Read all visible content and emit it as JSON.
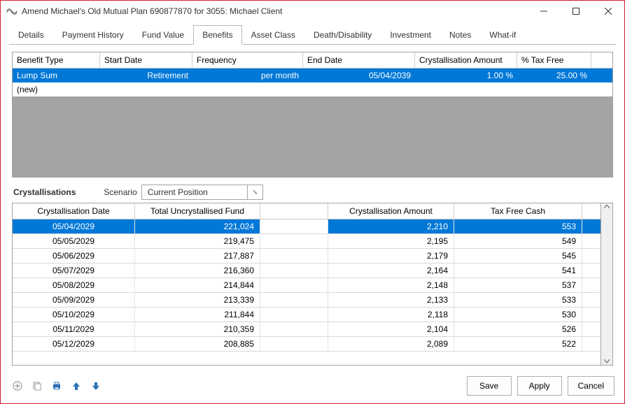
{
  "window": {
    "title": "Amend Michael's Old Mutual Plan 690877870 for 3055: Michael Client"
  },
  "tabs": [
    "Details",
    "Payment History",
    "Fund Value",
    "Benefits",
    "Asset Class",
    "Death/Disability",
    "Investment",
    "Notes",
    "What-if"
  ],
  "active_tab_index": 3,
  "benefit_grid": {
    "headers": [
      "Benefit Type",
      "Start Date",
      "Frequency",
      "End Date",
      "Crystallisation Amount",
      "% Tax Free"
    ],
    "rows": [
      {
        "selected": true,
        "cells": [
          "Lump Sum",
          "Retirement",
          "per month",
          "05/04/2039",
          "1.00 %",
          "25.00 %"
        ]
      },
      {
        "selected": false,
        "cells": [
          "(new)",
          "",
          "",
          "",
          "",
          ""
        ]
      }
    ]
  },
  "cryst_section": {
    "title": "Crystallisations",
    "scenario_label": "Scenario",
    "scenario_value": "Current Position"
  },
  "cryst_grid": {
    "headers": [
      "Crystallisation Date",
      "Total Uncrystallised Fund",
      "",
      "Crystallisation Amount",
      "Tax Free Cash"
    ],
    "rows": [
      {
        "selected": true,
        "cells": [
          "05/04/2029",
          "221,024",
          "",
          "2,210",
          "553"
        ]
      },
      {
        "selected": false,
        "cells": [
          "05/05/2029",
          "219,475",
          "",
          "2,195",
          "549"
        ]
      },
      {
        "selected": false,
        "cells": [
          "05/06/2029",
          "217,887",
          "",
          "2,179",
          "545"
        ]
      },
      {
        "selected": false,
        "cells": [
          "05/07/2029",
          "216,360",
          "",
          "2,164",
          "541"
        ]
      },
      {
        "selected": false,
        "cells": [
          "05/08/2029",
          "214,844",
          "",
          "2,148",
          "537"
        ]
      },
      {
        "selected": false,
        "cells": [
          "05/09/2029",
          "213,339",
          "",
          "2,133",
          "533"
        ]
      },
      {
        "selected": false,
        "cells": [
          "05/10/2029",
          "211,844",
          "",
          "2,118",
          "530"
        ]
      },
      {
        "selected": false,
        "cells": [
          "05/11/2029",
          "210,359",
          "",
          "2,104",
          "526"
        ]
      },
      {
        "selected": false,
        "cells": [
          "05/12/2029",
          "208,885",
          "",
          "2,089",
          "522"
        ]
      }
    ]
  },
  "buttons": {
    "save": "Save",
    "apply": "Apply",
    "cancel": "Cancel"
  }
}
